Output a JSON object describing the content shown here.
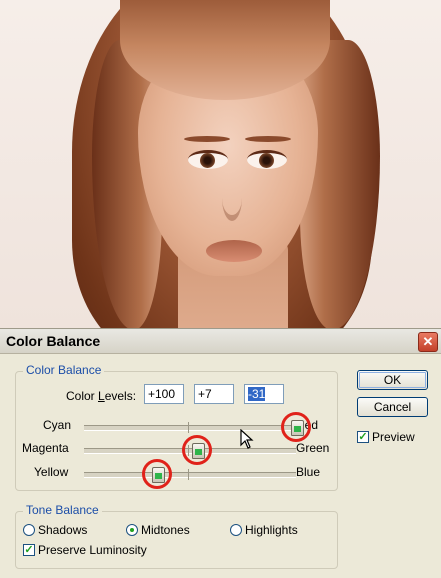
{
  "dialog": {
    "title": "Color Balance",
    "close_glyph": "✕"
  },
  "color_balance": {
    "group_label": "Color Balance",
    "levels_label": "Color Levels:",
    "levels": [
      "+100",
      "+7",
      "-31"
    ],
    "sliders": [
      {
        "left_label": "Cyan",
        "right_label": "Red",
        "value": 100
      },
      {
        "left_label": "Magenta",
        "right_label": "Green",
        "value": 7
      },
      {
        "left_label": "Yellow",
        "right_label": "Blue",
        "value": -31
      }
    ]
  },
  "buttons": {
    "ok": "OK",
    "cancel": "Cancel"
  },
  "preview": {
    "label": "Preview",
    "checked": true
  },
  "tone_balance": {
    "group_label": "Tone Balance",
    "options": [
      {
        "label": "Shadows",
        "selected": false
      },
      {
        "label": "Midtones",
        "selected": true
      },
      {
        "label": "Highlights",
        "selected": false
      }
    ],
    "preserve_luminosity": {
      "label": "Preserve Luminosity",
      "checked": true
    }
  },
  "icons": {
    "checkmark": "✓",
    "thumb": "slider-thumb-icon",
    "cursor": "mouse-cursor-icon"
  },
  "colors": {
    "group_label": "#1c4ea8",
    "highlight_ring": "#e0221a",
    "dialog_bg": "#ece9d8"
  }
}
